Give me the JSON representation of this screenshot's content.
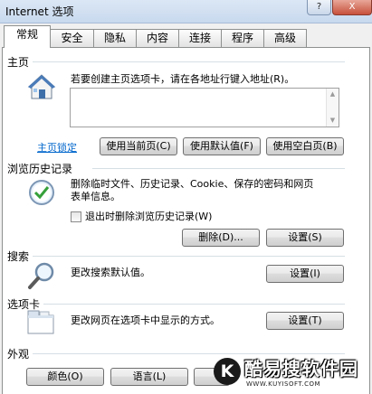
{
  "window": {
    "title": "Internet 选项",
    "help_button": "?",
    "close_button": "X"
  },
  "tabs": [
    "常规",
    "安全",
    "隐私",
    "内容",
    "连接",
    "程序",
    "高级"
  ],
  "active_tab": "常规",
  "homepage": {
    "header": "主页",
    "description": "若要创建主页选项卡，请在各地址行键入地址(R)。",
    "url_value": "",
    "lock_link": "主页锁定",
    "use_current": "使用当前页(C)",
    "use_default": "使用默认值(F)",
    "use_blank": "使用空白页(B)"
  },
  "history": {
    "header": "浏览历史记录",
    "description_line1": "删除临时文件、历史记录、Cookie、保存的密码和网页",
    "description_line2": "表单信息。",
    "checkbox_label": "退出时删除浏览历史记录(W)",
    "checkbox_checked": false,
    "delete_button": "删除(D)...",
    "settings_button": "设置(S)"
  },
  "search": {
    "header": "搜索",
    "description": "更改搜索默认值。",
    "settings_button": "设置(I)"
  },
  "tabs_section": {
    "header": "选项卡",
    "description": "更改网页在选项卡中显示的方式。",
    "settings_button": "设置(T)"
  },
  "appearance": {
    "header": "外观",
    "colors_button": "颜色(O)",
    "language_button": "语言(L)"
  },
  "watermark": {
    "logo_letter": "K",
    "text": "酷易搜软件园",
    "url": "WWW.KUYISOFT.COM"
  },
  "colors": {
    "link": "#0066cc",
    "panel_bg": "#ffffff",
    "dialog_bg": "#f0f0f0"
  }
}
